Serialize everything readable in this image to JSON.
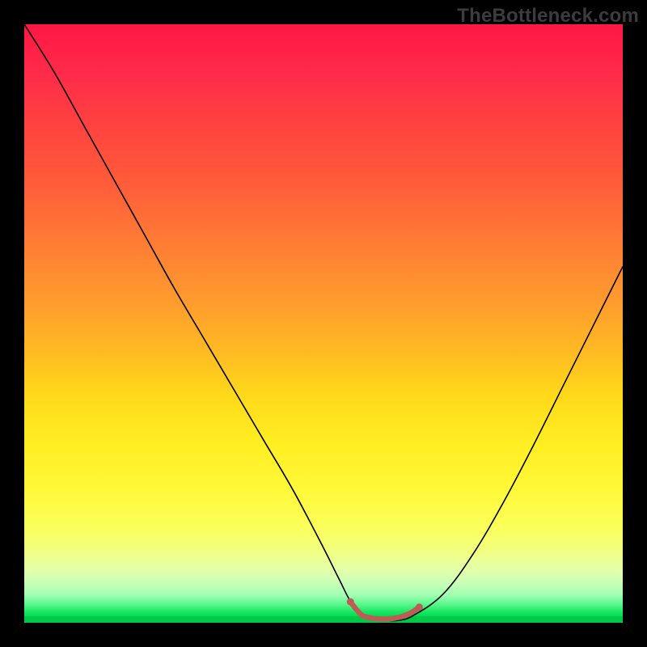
{
  "watermark": "TheBottleneck.com",
  "colors": {
    "page_bg": "#000000",
    "curve": "#000000",
    "marker": "#bf5b55",
    "gradient_top": "#ff1744",
    "gradient_bottom": "#00c946"
  },
  "chart_data": {
    "type": "line",
    "title": "",
    "xlabel": "",
    "ylabel": "",
    "xlim": [
      0,
      1
    ],
    "ylim": [
      0,
      1
    ],
    "legend": false,
    "grid": false,
    "axes_visible": false,
    "background": "red-orange-yellow-green vertical gradient (red at top = high, green at bottom = low)",
    "series": [
      {
        "name": "bottleneck-curve",
        "x": [
          0.0,
          0.05,
          0.1,
          0.15,
          0.2,
          0.25,
          0.3,
          0.35,
          0.4,
          0.45,
          0.5,
          0.525,
          0.55,
          0.575,
          0.6,
          0.625,
          0.65,
          0.7,
          0.75,
          0.8,
          0.85,
          0.9,
          0.95,
          1.0
        ],
        "y": [
          1.0,
          0.92,
          0.83,
          0.74,
          0.65,
          0.56,
          0.475,
          0.39,
          0.305,
          0.22,
          0.125,
          0.075,
          0.028,
          0.01,
          0.004,
          0.004,
          0.012,
          0.048,
          0.115,
          0.2,
          0.295,
          0.395,
          0.495,
          0.595
        ]
      }
    ],
    "marker": {
      "name": "optimal-range",
      "x": [
        0.545,
        0.555,
        0.565,
        0.575,
        0.585,
        0.6,
        0.615,
        0.63,
        0.645,
        0.66
      ],
      "y": [
        0.035,
        0.022,
        0.012,
        0.009,
        0.007,
        0.006,
        0.007,
        0.01,
        0.016,
        0.026
      ]
    },
    "marker_endpoint_dots": true
  }
}
